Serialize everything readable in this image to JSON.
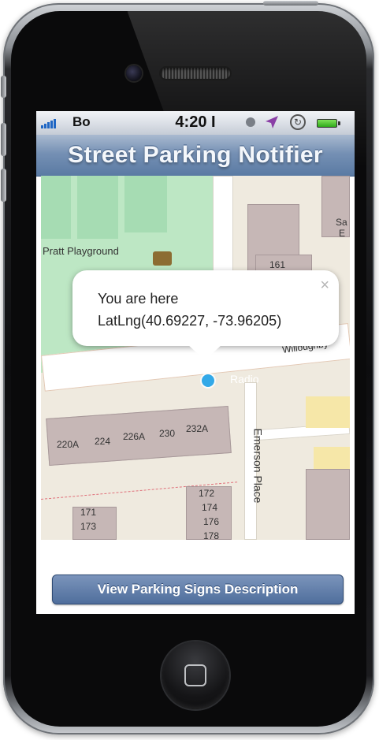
{
  "status_bar": {
    "carrier": "Bo",
    "time": "4:20 I"
  },
  "nav": {
    "title": "Street Parking Notifier"
  },
  "map": {
    "labels": {
      "playground": "Pratt Playground",
      "sa": "Sa",
      "e": "E",
      "bldg_161": "161",
      "street": "Willoughby",
      "radio": "Radio",
      "b220a": "220A",
      "b224": "224",
      "b226a": "226A",
      "b230": "230",
      "b232a": "232A",
      "emerson": "Emerson Place",
      "b171": "171",
      "b173": "173",
      "b172": "172",
      "b174": "174",
      "b176": "176",
      "b178": "178"
    },
    "popup": {
      "line1": "You are here",
      "line2": "LatLng(40.69227, -73.96205)",
      "close": "×"
    }
  },
  "actions": {
    "view_button": "View Parking Signs Description"
  },
  "colors": {
    "nav_blue": "#5a7aa3",
    "pin": "#33a9e8",
    "park": "#bde7c4"
  }
}
